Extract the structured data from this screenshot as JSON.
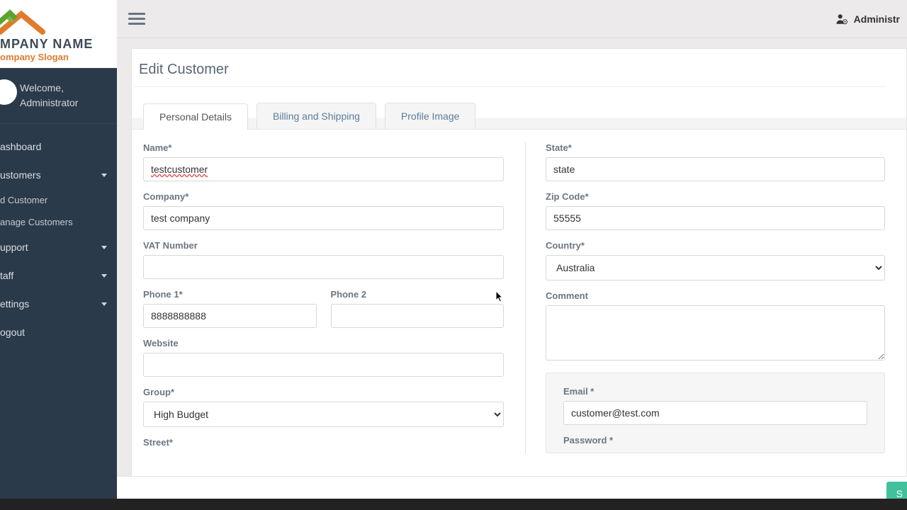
{
  "brand": {
    "company": "MPANY NAME",
    "slogan": "ompany Slogan"
  },
  "welcome": {
    "greeting": "Welcome,",
    "username": "Administrator"
  },
  "nav": {
    "dashboard": "ashboard",
    "customers": "ustomers",
    "add_customer": "d Customer",
    "manage_customers": "anage Customers",
    "support": "upport",
    "staff": "taff",
    "settings": "ettings",
    "logout": "ogout"
  },
  "topbar": {
    "user": "Administr"
  },
  "page": {
    "title": "Edit Customer"
  },
  "tabs": {
    "personal": "Personal Details",
    "billing": "Billing and Shipping",
    "profile_image": "Profile Image"
  },
  "labels": {
    "name": "Name*",
    "company": "Company*",
    "vat": "VAT Number",
    "phone1": "Phone 1*",
    "phone2": "Phone 2",
    "website": "Website",
    "group": "Group*",
    "street": "Street*",
    "state": "State*",
    "zip": "Zip Code*",
    "country": "Country*",
    "comment": "Comment",
    "email": "Email *",
    "password": "Password *"
  },
  "values": {
    "name": "testcustomer",
    "company": "test company",
    "vat": "",
    "phone1": "8888888888",
    "phone2": "",
    "website": "",
    "group": "High Budget",
    "state": "state",
    "zip": "55555",
    "country": "Australia",
    "comment": "",
    "email": "customer@test.com"
  },
  "buttons": {
    "save": "S"
  }
}
